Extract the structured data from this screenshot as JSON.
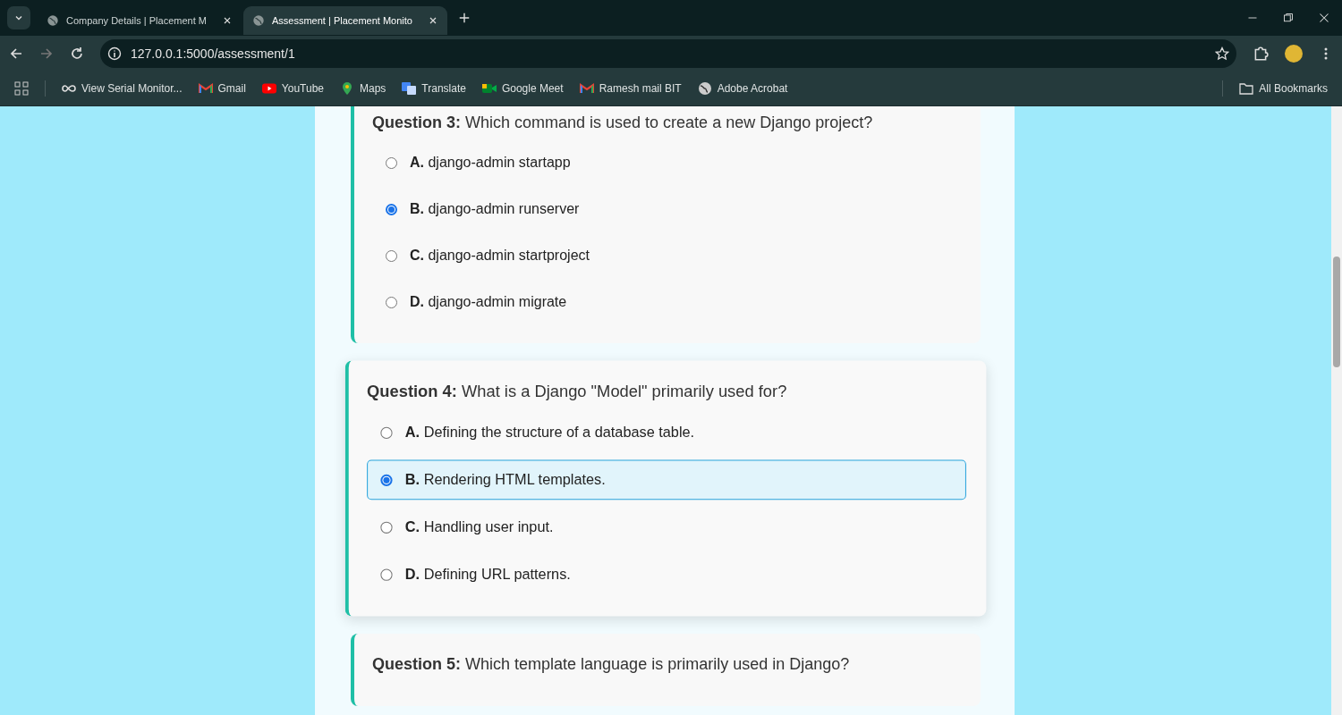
{
  "browser": {
    "tabs": [
      {
        "title": "Company Details | Placement M",
        "selected": false
      },
      {
        "title": "Assessment | Placement Monito",
        "selected": true
      }
    ],
    "address": "127.0.0.1:5000/assessment/1",
    "bookmarks": [
      {
        "kind": "link",
        "label": "View Serial Monitor..."
      },
      {
        "kind": "mail",
        "label": "Gmail"
      },
      {
        "kind": "video",
        "label": "YouTube"
      },
      {
        "kind": "pin",
        "label": "Maps"
      },
      {
        "kind": "translate",
        "label": "Translate"
      },
      {
        "kind": "camera",
        "label": "Google Meet"
      },
      {
        "kind": "mail",
        "label": "Ramesh mail BIT"
      },
      {
        "kind": "globe",
        "label": "Adobe Acrobat"
      }
    ],
    "all_bookmarks": "All Bookmarks"
  },
  "questions": [
    {
      "raised": false,
      "text": "**Question 3:** Which command is used to create a new Django project?",
      "options": [
        {
          "text": "**A.** django-admin startapp",
          "selected": false,
          "highlighted": false
        },
        {
          "text": "**B.** django-admin runserver",
          "selected": true,
          "highlighted": false
        },
        {
          "text": "**C.** django-admin startproject",
          "selected": false,
          "highlighted": false
        },
        {
          "text": "**D.** django-admin migrate",
          "selected": false,
          "highlighted": false
        }
      ]
    },
    {
      "raised": true,
      "text": "**Question 4:** What is a Django \"Model\" primarily used for?",
      "options": [
        {
          "text": "**A.** Defining the structure of a database table.",
          "selected": false,
          "highlighted": false
        },
        {
          "text": "**B.** Rendering HTML templates.",
          "selected": true,
          "highlighted": true
        },
        {
          "text": "**C.** Handling user input.",
          "selected": false,
          "highlighted": false
        },
        {
          "text": "**D.** Defining URL patterns.",
          "selected": false,
          "highlighted": false
        }
      ]
    },
    {
      "raised": false,
      "text": "**Question 5:** Which template language is primarily used in Django?"
    }
  ]
}
